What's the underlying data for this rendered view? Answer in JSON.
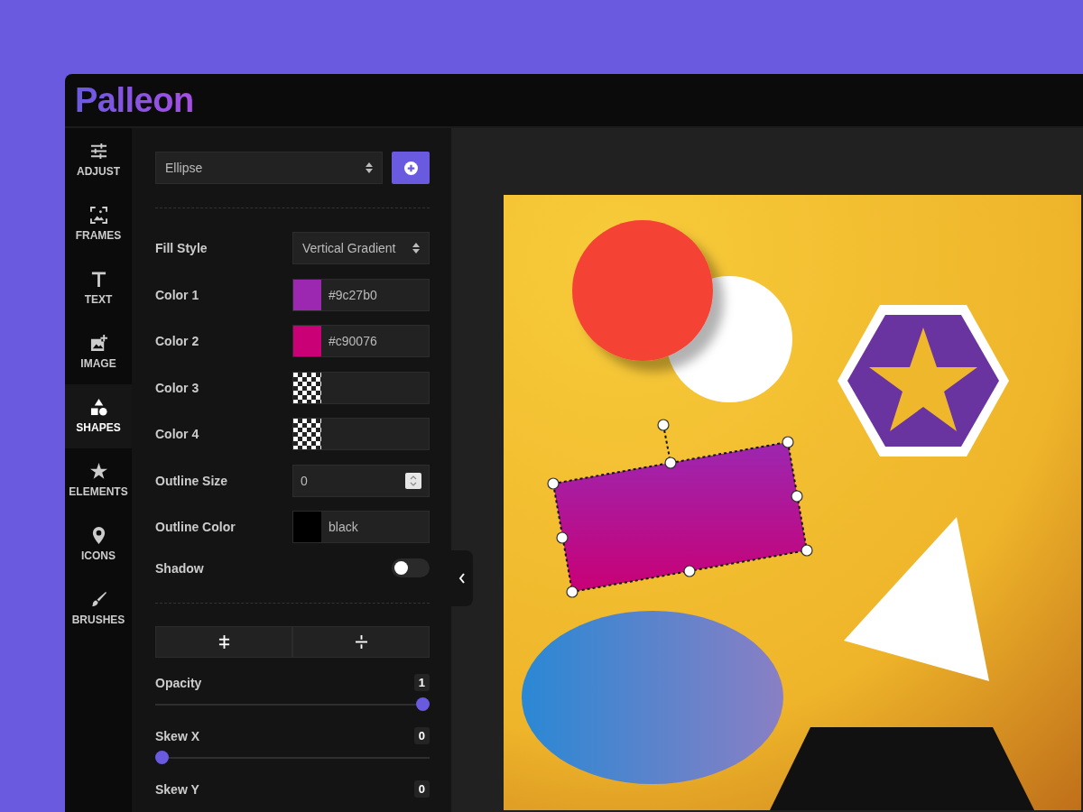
{
  "logo": "Palleon",
  "sidebar": {
    "items": [
      {
        "label": "ADJUST",
        "selected": false
      },
      {
        "label": "FRAMES",
        "selected": false
      },
      {
        "label": "TEXT",
        "selected": false
      },
      {
        "label": "IMAGE",
        "selected": false
      },
      {
        "label": "SHAPES",
        "selected": true
      },
      {
        "label": "ELEMENTS",
        "selected": false
      },
      {
        "label": "ICONS",
        "selected": false
      },
      {
        "label": "BRUSHES",
        "selected": false
      }
    ]
  },
  "shape_select": {
    "value": "Ellipse"
  },
  "fields": [
    {
      "kind": "select",
      "label": "Fill Style",
      "value": "Vertical Gradient"
    },
    {
      "kind": "color",
      "label": "Color 1",
      "color": "#9c27b0",
      "value": "#9c27b0"
    },
    {
      "kind": "color",
      "label": "Color 2",
      "color": "#c90076",
      "value": "#c90076"
    },
    {
      "kind": "empty",
      "label": "Color 3"
    },
    {
      "kind": "empty",
      "label": "Color 4"
    },
    {
      "kind": "number",
      "label": "Outline Size",
      "value": "0"
    },
    {
      "kind": "color",
      "label": "Outline Color",
      "color": "#000000",
      "value": "black"
    },
    {
      "kind": "toggle",
      "label": "Shadow",
      "on": false
    }
  ],
  "sliders": [
    {
      "label": "Opacity",
      "reading": "1",
      "level": 1
    },
    {
      "label": "Skew X",
      "reading": "0",
      "level": 0
    },
    {
      "label": "Skew Y",
      "reading": "0"
    }
  ]
}
